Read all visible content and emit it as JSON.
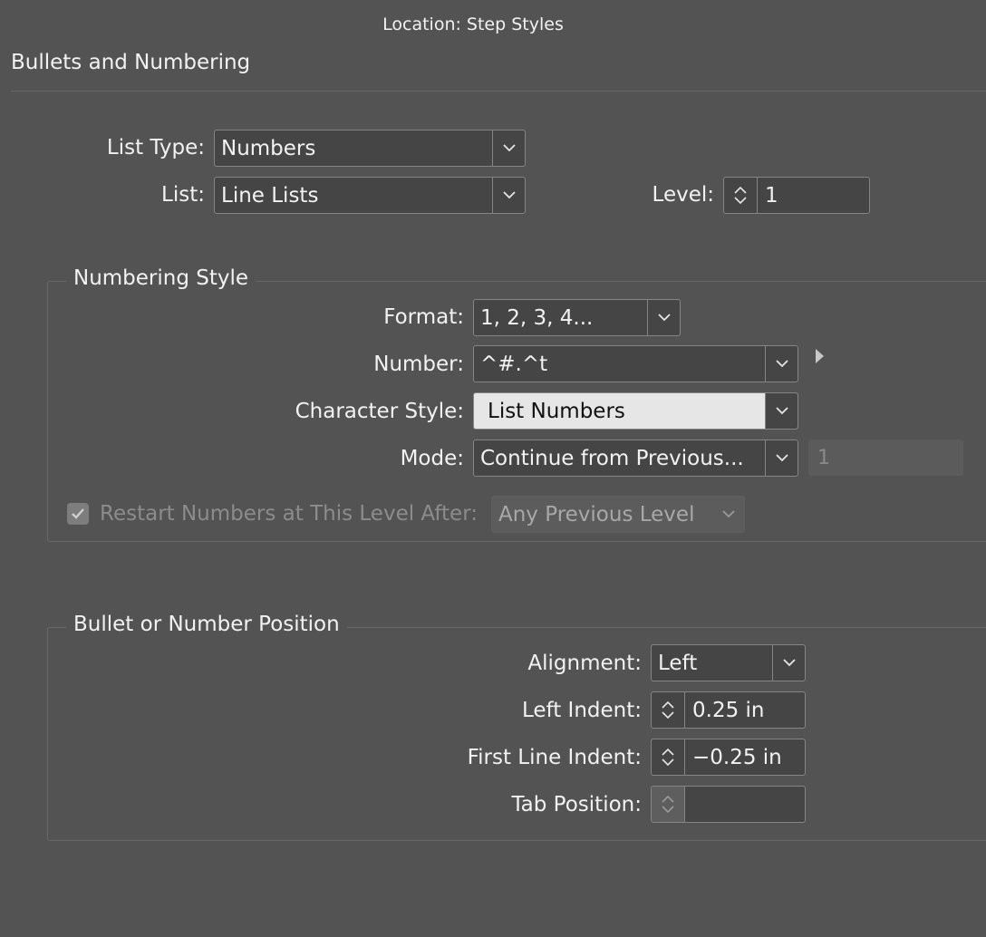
{
  "header": {
    "location": "Location:  Step Styles"
  },
  "section": {
    "title": "Bullets and Numbering"
  },
  "list_type": {
    "label": "List Type:",
    "value": "Numbers"
  },
  "list": {
    "label": "List:",
    "value": "Line Lists"
  },
  "level": {
    "label": "Level:",
    "value": "1"
  },
  "numbering_style": {
    "title": "Numbering Style",
    "format": {
      "label": "Format:",
      "value": "1, 2, 3, 4..."
    },
    "number": {
      "label": "Number:",
      "value": "^#.^t"
    },
    "character_style": {
      "label": "Character Style:",
      "value": "List Numbers"
    },
    "mode": {
      "label": "Mode:",
      "value": "Continue from Previous...",
      "start_value": "1"
    },
    "restart": {
      "label": "Restart Numbers at This Level After:",
      "checked": true,
      "value": "Any Previous Level"
    }
  },
  "position": {
    "title": "Bullet or Number Position",
    "alignment": {
      "label": "Alignment:",
      "value": "Left"
    },
    "left_indent": {
      "label": "Left Indent:",
      "value": "0.25 in"
    },
    "first_line_indent": {
      "label": "First Line Indent:",
      "value": "−0.25 in"
    },
    "tab_position": {
      "label": "Tab Position:",
      "value": ""
    }
  },
  "icons": {
    "dropdown": "chevron-down-icon",
    "stepper": "stepper-icon",
    "flyout": "flyout-arrow-icon",
    "check": "check-icon"
  },
  "colors": {
    "background": "#535353",
    "field": "#454545",
    "border": "#858585",
    "highlight_field": "#e6e6e6"
  }
}
